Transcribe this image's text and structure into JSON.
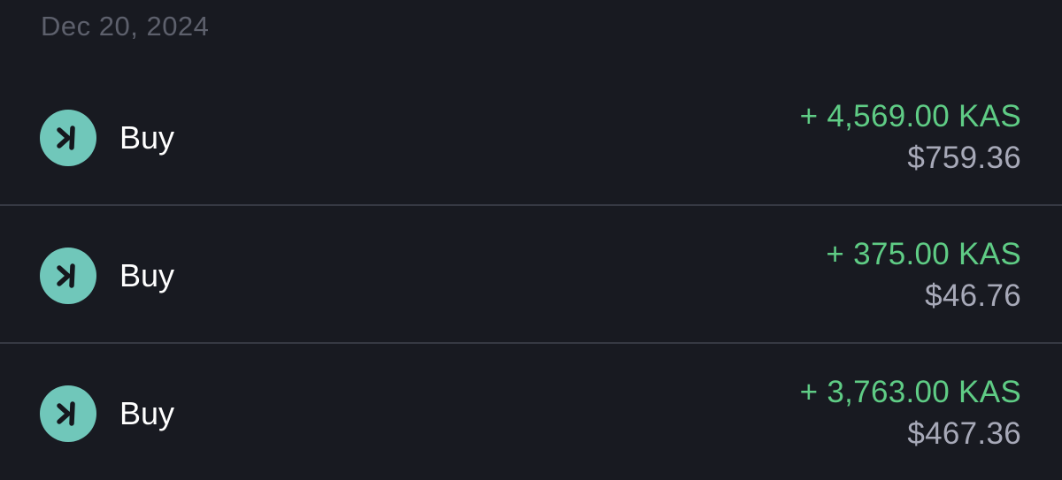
{
  "colors": {
    "background": "#181a21",
    "date_text": "#5d606c",
    "divider": "#363943",
    "icon_bg": "#70c7ba",
    "icon_glyph": "#15171d",
    "type_text": "#ffffff",
    "amount_positive": "#5fcc85",
    "fiat_text": "#a7a9b8"
  },
  "date_header": "Dec 20, 2024",
  "transactions": [
    {
      "icon": "kaspa-icon",
      "type": "Buy",
      "amount": "+ 4,569.00 KAS",
      "fiat": "$759.36"
    },
    {
      "icon": "kaspa-icon",
      "type": "Buy",
      "amount": "+ 375.00 KAS",
      "fiat": "$46.76"
    },
    {
      "icon": "kaspa-icon",
      "type": "Buy",
      "amount": "+ 3,763.00 KAS",
      "fiat": "$467.36"
    }
  ]
}
